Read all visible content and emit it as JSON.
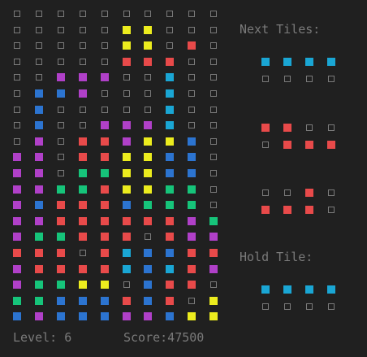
{
  "colors": {
    "empty": "#7a7a7a",
    "R": "#e84a4a",
    "Y": "#ecec1e",
    "M": "#b040c8",
    "B": "#2c74d0",
    "C": "#1aa6d4",
    "G": "#16c47a",
    "background": "#202020",
    "text": "#7a7a7a"
  },
  "board": {
    "rows": [
      "..........",
      ".....YY...",
      ".....YY.R.",
      ".....RRR..",
      "..MMM..C..",
      ".BBM...C..",
      ".B.....C..",
      ".B..MMMC..",
      ".M.RRMYYB.",
      "MM.RRYYBB.",
      "MM.GGYYBB.",
      "MMGGRYYGG.",
      "MBRRRBGGG.",
      "MMRRRRRRMG",
      "MGGRRR.RMM",
      "RRR.RCBBRR",
      "MRRRRCBCRM",
      "MGGYY.BRR.",
      "GGBBBRBR.Y",
      "BMBBBMMBYY"
    ]
  },
  "next_tiles": {
    "label": "Next Tiles:",
    "pieces": [
      {
        "rows": [
          "CCCC",
          "...."
        ]
      },
      {
        "rows": [
          "RR..",
          ".RRR"
        ]
      },
      {
        "rows": [
          "..R.",
          "RRR."
        ]
      }
    ]
  },
  "hold_tile": {
    "label": "Hold Tile:",
    "rows": [
      "CCCC",
      "...."
    ]
  },
  "status": {
    "level": "Level: 6",
    "score": "Score:47500"
  }
}
